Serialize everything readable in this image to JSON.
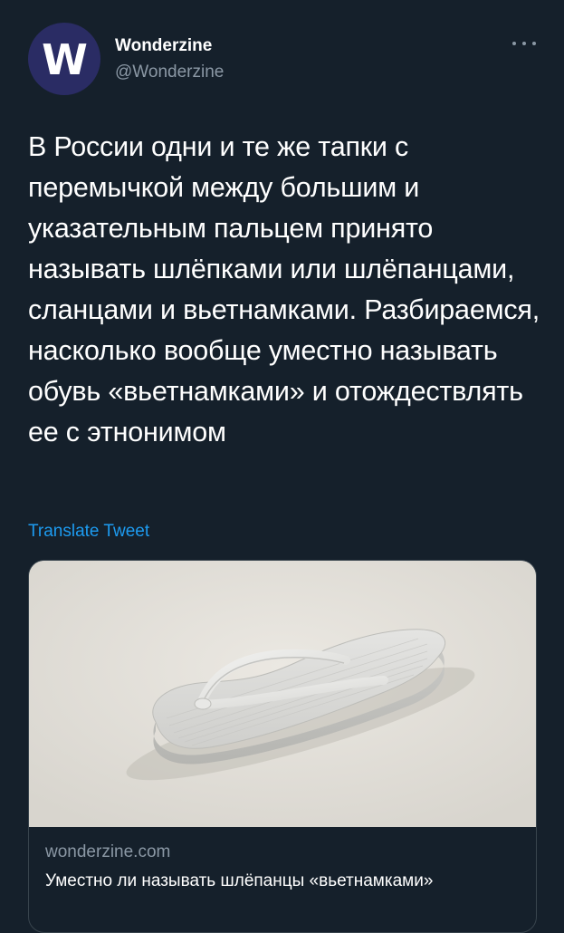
{
  "account": {
    "avatar_letter": "W",
    "display_name": "Wonderzine",
    "handle": "@Wonderzine"
  },
  "tweet": {
    "text": "В России одни и те же тапки с перемычкой между большим и указательным пальцем принято называть шлёпками или шлёпанцами, сланцами и вьетнамками. Разбираемся, насколько вообще уместно называть обувь «вьетнамками» и отождествлять ее с этнонимом",
    "translate_label": "Translate Tweet"
  },
  "card": {
    "domain": "wonderzine.com",
    "title": "Уместно ли называть шлёпанцы «вьетнамками»",
    "image_subject": "white flip-flop sandal"
  },
  "icons": {
    "more": "more-horizontal-icon"
  },
  "colors": {
    "background": "#15202b",
    "link": "#1d9bf0",
    "secondary_text": "#8b98a5",
    "avatar": "#2a2c64"
  }
}
